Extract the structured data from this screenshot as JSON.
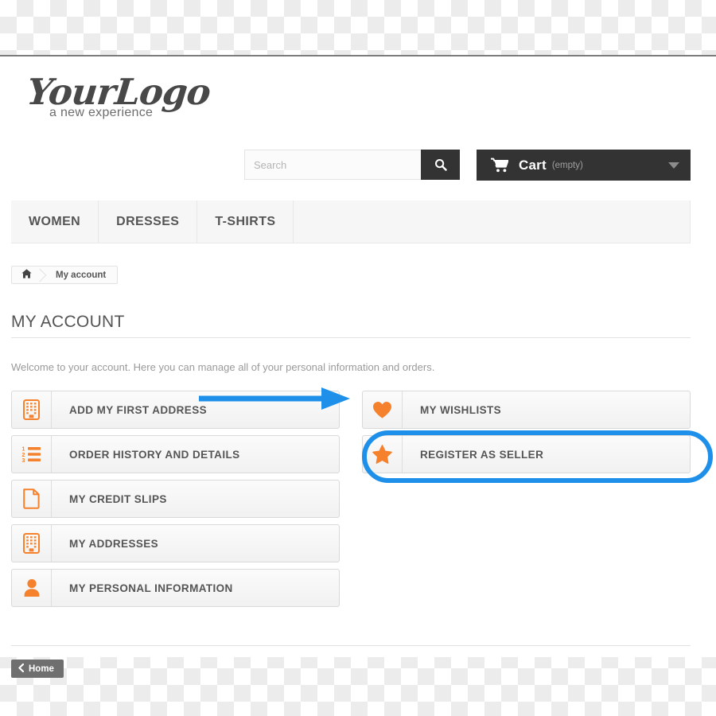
{
  "site": {
    "logo_main": "YourLogo",
    "logo_tagline": "a new experience"
  },
  "search": {
    "placeholder": "Search",
    "value": "",
    "button_icon": "search-icon"
  },
  "cart": {
    "icon": "shopping-cart-icon",
    "label": "Cart",
    "status": "(empty)",
    "caret_icon": "chevron-down-icon"
  },
  "nav": {
    "items": [
      {
        "label": "WOMEN"
      },
      {
        "label": "DRESSES"
      },
      {
        "label": "T-SHIRTS"
      }
    ]
  },
  "breadcrumb": {
    "home_icon": "home-icon",
    "current": "My account"
  },
  "page": {
    "title": "MY ACCOUNT",
    "welcome": "Welcome to your account. Here you can manage all of your personal information and orders."
  },
  "account_links": {
    "left_column": [
      {
        "label": "ADD MY FIRST ADDRESS",
        "icon": "building-address-icon"
      },
      {
        "label": "ORDER HISTORY AND DETAILS",
        "icon": "ordered-list-icon"
      },
      {
        "label": "MY CREDIT SLIPS",
        "icon": "document-page-icon"
      },
      {
        "label": "MY ADDRESSES",
        "icon": "building-address-icon"
      },
      {
        "label": "MY PERSONAL INFORMATION",
        "icon": "user-person-icon"
      }
    ],
    "right_column": [
      {
        "label": "MY WISHLISTS",
        "icon": "heart-icon"
      },
      {
        "label": "REGISTER AS SELLER",
        "icon": "star-icon"
      }
    ]
  },
  "annotation": {
    "highlight_target": "REGISTER AS SELLER",
    "arrow_icon": "right-arrow-annotation",
    "highlight_color": "#1e90ea",
    "arrow_color": "#1e90ea"
  },
  "footer": {
    "home_button": "Home",
    "home_chevron_icon": "chevron-left-icon"
  },
  "theme": {
    "accent_orange": "#f6812c",
    "dark_bar": "#333333",
    "text_gray": "#555555"
  }
}
